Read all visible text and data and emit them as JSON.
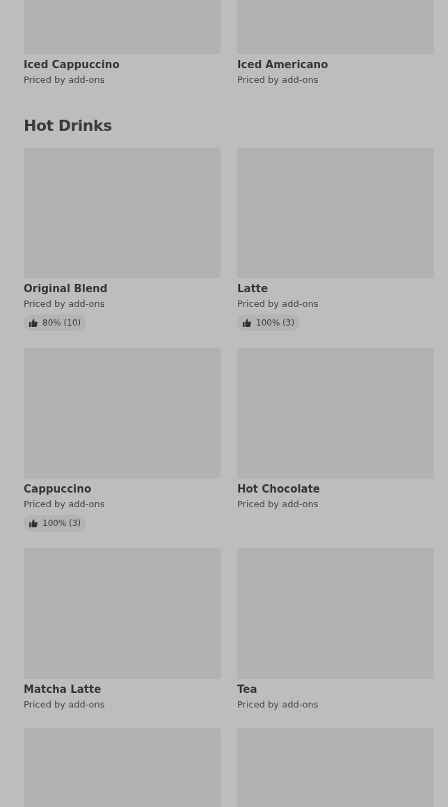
{
  "sections": [
    {
      "items": [
        {
          "kind": "product",
          "name": "Iced Cappuccino",
          "subtitle": "Priced by add-ons"
        },
        {
          "kind": "product",
          "name": "Iced Americano",
          "subtitle": "Priced by add-ons"
        }
      ]
    },
    {
      "heading": "Hot Drinks",
      "items": [
        {
          "kind": "product",
          "name": "Original Blend",
          "subtitle": "Priced by add-ons",
          "rating": "80% (10)"
        },
        {
          "kind": "product",
          "name": "Latte",
          "subtitle": "Priced by add-ons",
          "rating": "100% (3)"
        },
        {
          "kind": "product",
          "name": "Cappuccino",
          "subtitle": "Priced by add-ons",
          "rating": "100% (3)"
        },
        {
          "kind": "product",
          "name": "Hot Chocolate",
          "subtitle": "Priced by add-ons"
        },
        {
          "kind": "product",
          "name": "Matcha Latte",
          "subtitle": "Priced by add-ons"
        },
        {
          "kind": "product",
          "name": "Tea",
          "subtitle": "Priced by add-ons"
        },
        {
          "kind": "image"
        },
        {
          "kind": "image"
        }
      ]
    }
  ]
}
